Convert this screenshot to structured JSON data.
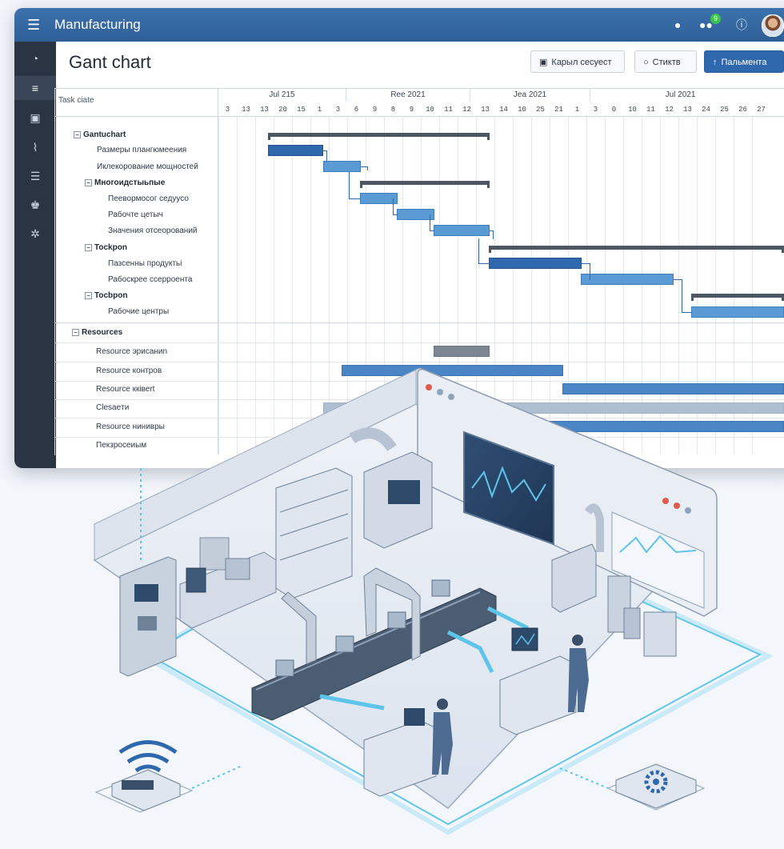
{
  "app": {
    "title": "Manufacturing",
    "notification_count": "9"
  },
  "page": {
    "title": "Gant chart"
  },
  "toolbar": {
    "btn1_label": "Карыл сесуест",
    "btn2_label": "Стиктв",
    "btn3_label": "Пальмента"
  },
  "sidebar": {
    "items": [
      {
        "icon": "dashboard-icon",
        "glyph": "◔"
      },
      {
        "icon": "list-icon",
        "glyph": "≡"
      },
      {
        "icon": "calendar-icon",
        "glyph": "▣"
      },
      {
        "icon": "chart-icon",
        "glyph": "⌇"
      },
      {
        "icon": "database-icon",
        "glyph": "☰"
      },
      {
        "icon": "users-icon",
        "glyph": "♚"
      },
      {
        "icon": "settings-icon",
        "glyph": "✲"
      }
    ]
  },
  "gantt": {
    "task_header": "Task ciate",
    "months": [
      "Jul 215",
      "Ree 2021",
      "Jea 2021",
      "Jul 2021"
    ],
    "days": [
      "3",
      "13",
      "13",
      "20",
      "15",
      "1",
      "3",
      "6",
      "9",
      "8",
      "9",
      "10",
      "11",
      "12",
      "13",
      "14",
      "10",
      "25",
      "21",
      "1",
      "3",
      "0",
      "10",
      "11",
      "12",
      "13",
      "24",
      "25",
      "26",
      "27"
    ],
    "tasks": [
      {
        "label": "Gantuchart",
        "group": true
      },
      {
        "label": "Размеры плангюмеения",
        "group": false
      },
      {
        "label": "Иклекорование мощностей",
        "group": false
      },
      {
        "label": "Многоидстыьпые",
        "group": true
      },
      {
        "label": "Пеевормосог седуусо",
        "group": false
      },
      {
        "label": "Рабочте цетыч",
        "group": false
      },
      {
        "label": "Значения отсеорований",
        "group": false
      },
      {
        "label": "Tockpon",
        "group": true
      },
      {
        "label": "Пазсенны продуктьі",
        "group": false
      },
      {
        "label": "Рабоскрее ссерроента",
        "group": false
      },
      {
        "label": "Tocbpon",
        "group": true
      },
      {
        "label": "Рабочие центры",
        "group": false
      }
    ],
    "resources_header": "Resources",
    "resources": [
      "Resource эрисаниn",
      "Resource контров",
      "Resource кківеrt",
      "Сlesaeти",
      "Resource нинивры",
      "Пекзросеиым"
    ]
  },
  "colors": {
    "topbar": "#3d72ad",
    "sidebar": "#2a3442",
    "bar": "#5b9bd5",
    "bar_dark": "#2f68ad",
    "summary": "#4d5663"
  }
}
